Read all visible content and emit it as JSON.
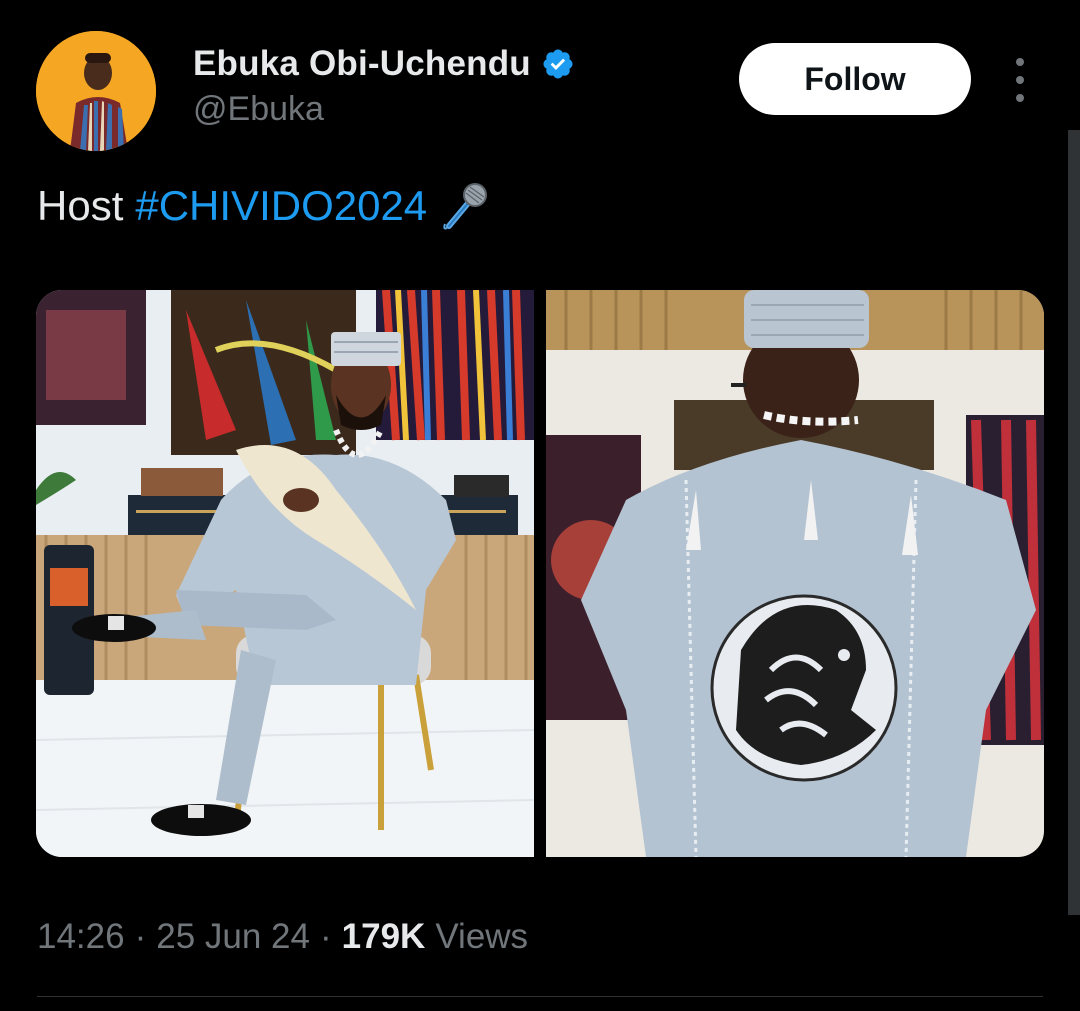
{
  "author": {
    "name": "Ebuka Obi-Uchendu",
    "handle": "@Ebuka",
    "verified": true,
    "avatar_bg": "#f5a623"
  },
  "actions": {
    "follow_label": "Follow",
    "more_icon": "more-vertical-icon"
  },
  "tweet": {
    "text_plain": "Host",
    "hashtag": "#CHIVIDO2024",
    "emoji_icon": "microphone-icon"
  },
  "media": {
    "count": 2,
    "items": [
      "photo-seated-man-in-agbada",
      "photo-back-of-agbada-with-panther-emblem"
    ]
  },
  "meta": {
    "time": "14:26",
    "date": "25 Jun 24",
    "views_count": "179K",
    "views_label": "Views",
    "separator": "·"
  },
  "colors": {
    "background": "#000000",
    "text_primary": "#e7e9ea",
    "text_secondary": "#71767b",
    "link": "#1d9bf0",
    "verified": "#1d9bf0"
  }
}
